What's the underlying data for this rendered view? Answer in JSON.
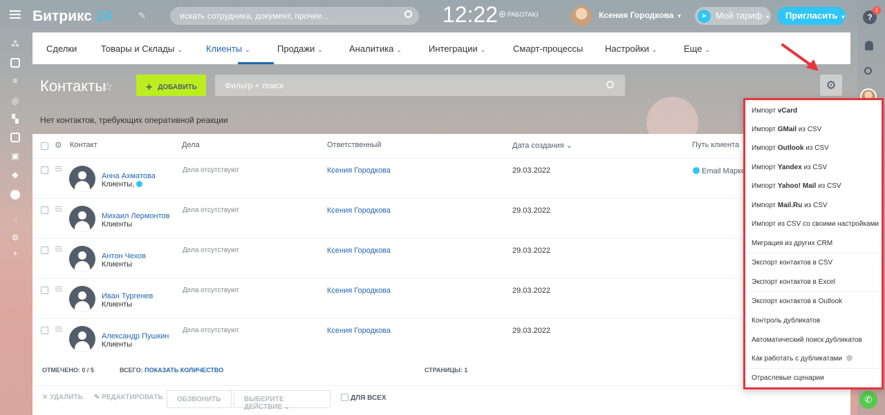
{
  "header": {
    "logo_main": "Битрикс",
    "logo_num": "24",
    "search_placeholder": "искать сотрудника, документ, прочее...",
    "clock": "12:22",
    "work_status": "РАБОТАЮ",
    "user_name": "Ксения Городкова",
    "tariff": "Мой тариф",
    "invite": "Пригласить",
    "notifications_count": "1",
    "help": "?"
  },
  "nav": {
    "items": [
      "Сделки",
      "Товары и Склады",
      "Клиенты",
      "Продажи",
      "Аналитика",
      "Интеграции",
      "Смарт-процессы",
      "Настройки",
      "Еще"
    ],
    "active": "Клиенты"
  },
  "toolbar": {
    "title": "Контакты",
    "add": "ДОБАВИТЬ",
    "filter_placeholder": "Фильтр + поиск"
  },
  "notice": "Нет контактов, требующих оперативной реакции",
  "grid": {
    "columns": [
      "Контакт",
      "Дела",
      "Ответственный",
      "Дата создания",
      "Путь клиента"
    ],
    "rows": [
      {
        "name": "Анна Ахматова",
        "type": "Клиенты,",
        "deals": "Дела отсутствуют",
        "resp": "Ксения Городкова",
        "date": "29.03.2022",
        "path": "Email Марке"
      },
      {
        "name": "Михаил Лермонтов",
        "type": "Клиенты",
        "deals": "Дела отсутствуют",
        "resp": "Ксения Городкова",
        "date": "29.03.2022",
        "path": ""
      },
      {
        "name": "Антон Чехов",
        "type": "Клиенты",
        "deals": "Дела отсутствуют",
        "resp": "Ксения Городкова",
        "date": "29.03.2022",
        "path": ""
      },
      {
        "name": "Иван Тургенев",
        "type": "Клиенты",
        "deals": "Дела отсутствуют",
        "resp": "Ксения Городкова",
        "date": "29.03.2022",
        "path": ""
      },
      {
        "name": "Александр Пушкин",
        "type": "Клиенты",
        "deals": "Дела отсутствуют",
        "resp": "Ксения Городкова",
        "date": "29.03.2022",
        "path": ""
      }
    ],
    "footer": {
      "marked_label": "ОТМЕЧЕНО:",
      "marked_value": "0 / 5",
      "total_label": "ВСЕГО:",
      "total_link": "ПОКАЗАТЬ КОЛИЧЕСТВО",
      "pages_label": "СТРАНИЦЫ:",
      "pages_value": "1"
    },
    "actions": {
      "delete": "УДАЛИТЬ",
      "edit": "РЕДАКТИРОВАТЬ",
      "call": "ОБЗВОНИТЬ",
      "select_action": "ВЫБЕРИТЕ ДЕЙСТВИЕ",
      "for_all": "ДЛЯ ВСЕХ"
    }
  },
  "menu": {
    "items": [
      {
        "pre": "Импорт ",
        "bold": "vCard",
        "post": ""
      },
      {
        "pre": "Импорт ",
        "bold": "GMail",
        "post": " из CSV"
      },
      {
        "pre": "Импорт ",
        "bold": "Outlook",
        "post": " из CSV"
      },
      {
        "pre": "Импорт ",
        "bold": "Yandex",
        "post": " из CSV"
      },
      {
        "pre": "Импорт ",
        "bold": "Yahoo! Mail",
        "post": " из CSV"
      },
      {
        "pre": "Импорт ",
        "bold": "Mail.Ru",
        "post": " из CSV"
      },
      {
        "pre": "Импорт из CSV со своими настройками",
        "bold": "",
        "post": ""
      },
      {
        "pre": "Миграция из других CRM",
        "bold": "",
        "post": ""
      },
      {
        "pre": "Экспорт контактов в CSV",
        "bold": "",
        "post": ""
      },
      {
        "pre": "Экспорт контактов в Excel",
        "bold": "",
        "post": ""
      },
      {
        "pre": "Экспорт контактов в Outlook",
        "bold": "",
        "post": ""
      },
      {
        "pre": "Контроль дубликатов",
        "bold": "",
        "post": ""
      },
      {
        "pre": "Автоматический поиск дубликатов",
        "bold": "",
        "post": ""
      },
      {
        "pre": "Как работать с дубликатами",
        "bold": "",
        "post": ""
      },
      {
        "pre": "Отраслевые сценарии",
        "bold": "",
        "post": ""
      }
    ],
    "highlight_color": "#e8343d"
  },
  "colors": {
    "accent": "#2fc6f6",
    "link": "#2067b0",
    "add_button": "#bbed21"
  }
}
